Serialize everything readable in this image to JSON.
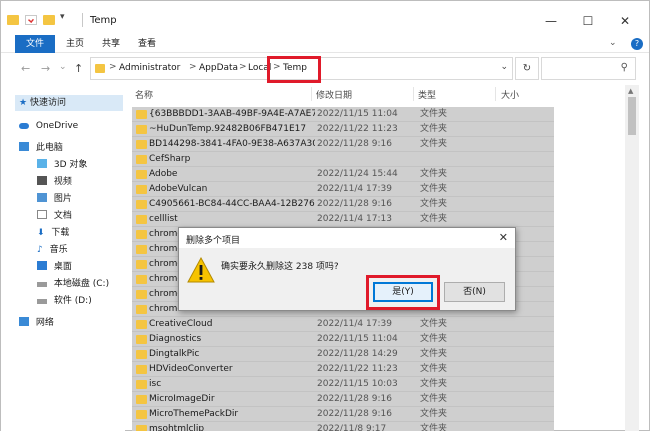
{
  "window": {
    "title": "Temp",
    "caption": {
      "minimize": "—",
      "maximize": "☐",
      "close": "✕"
    }
  },
  "ribbon": {
    "tabs": [
      "文件",
      "主页",
      "共享",
      "查看"
    ],
    "expand": "⌄",
    "help": "?"
  },
  "address": {
    "crumbs": [
      "Administrator",
      "AppData",
      "Local",
      "Temp"
    ],
    "separator": ">",
    "highlight_color": "#e01a2a"
  },
  "nav": {
    "back": "←",
    "forward": "→",
    "recent": "⌄",
    "up": "↑",
    "refresh": "↻",
    "search": "⚲",
    "dropdown": "⌄"
  },
  "sidebar": {
    "items": [
      {
        "label": "快速访问",
        "icon": "star-icon"
      },
      {
        "label": "OneDrive",
        "icon": "cloud-icon"
      },
      {
        "label": "此电脑",
        "icon": "computer-icon"
      },
      {
        "label": "3D 对象",
        "icon": "cube-icon"
      },
      {
        "label": "视频",
        "icon": "video-icon"
      },
      {
        "label": "图片",
        "icon": "picture-icon"
      },
      {
        "label": "文档",
        "icon": "document-icon"
      },
      {
        "label": "下载",
        "icon": "download-icon"
      },
      {
        "label": "音乐",
        "icon": "music-icon"
      },
      {
        "label": "桌面",
        "icon": "desktop-icon"
      },
      {
        "label": "本地磁盘 (C:)",
        "icon": "drive-icon"
      },
      {
        "label": "软件 (D:)",
        "icon": "drive-icon"
      },
      {
        "label": "网络",
        "icon": "network-icon"
      }
    ]
  },
  "columns": {
    "name": "名称",
    "modified": "修改日期",
    "type": "类型",
    "size": "大小"
  },
  "files": [
    {
      "name": "{63BBBDD1-3AAB-49BF-9A4E-A7AE7...",
      "date": "2022/11/15 11:04",
      "type": "文件夹"
    },
    {
      "name": "~HuDunTemp.92482B06FB471E17",
      "date": "2022/11/22 11:23",
      "type": "文件夹"
    },
    {
      "name": "BD144298-3841-4FA0-9E38-A637A30...",
      "date": "2022/11/28 9:16",
      "type": "文件夹"
    },
    {
      "name": "CefSharp",
      "date": "",
      "type": ""
    },
    {
      "name": "Adobe",
      "date": "2022/11/24 15:44",
      "type": "文件夹"
    },
    {
      "name": "AdobeVulcan",
      "date": "2022/11/4 17:39",
      "type": "文件夹"
    },
    {
      "name": "C4905661-BC84-44CC-BAA4-12B276F...",
      "date": "2022/11/28 9:16",
      "type": "文件夹"
    },
    {
      "name": "celllist",
      "date": "2022/11/4 17:13",
      "type": "文件夹"
    },
    {
      "name": "chrome",
      "date": "",
      "type": ""
    },
    {
      "name": "chrome",
      "date": "",
      "type": ""
    },
    {
      "name": "chrome",
      "date": "",
      "type": ""
    },
    {
      "name": "chrome",
      "date": "",
      "type": ""
    },
    {
      "name": "chrome",
      "date": "",
      "type": ""
    },
    {
      "name": "chrome",
      "date": "",
      "type": ""
    },
    {
      "name": "CreativeCloud",
      "date": "2022/11/4 17:39",
      "type": "文件夹"
    },
    {
      "name": "Diagnostics",
      "date": "2022/11/15 11:04",
      "type": "文件夹"
    },
    {
      "name": "DingtalkPic",
      "date": "2022/11/28 14:29",
      "type": "文件夹"
    },
    {
      "name": "HDVideoConverter",
      "date": "2022/11/22 11:23",
      "type": "文件夹"
    },
    {
      "name": "isc",
      "date": "2022/11/15 10:03",
      "type": "文件夹"
    },
    {
      "name": "MicroImageDir",
      "date": "2022/11/28 9:16",
      "type": "文件夹"
    },
    {
      "name": "MicroThemePackDir",
      "date": "2022/11/28 9:16",
      "type": "文件夹"
    },
    {
      "name": "msohtmlclip",
      "date": "2022/11/8 9:17",
      "type": "文件夹"
    }
  ],
  "dialog": {
    "title": "删除多个项目",
    "close": "✕",
    "message": "确实要永久删除这 238 项吗?",
    "yes": "是(Y)",
    "no": "否(N)"
  }
}
